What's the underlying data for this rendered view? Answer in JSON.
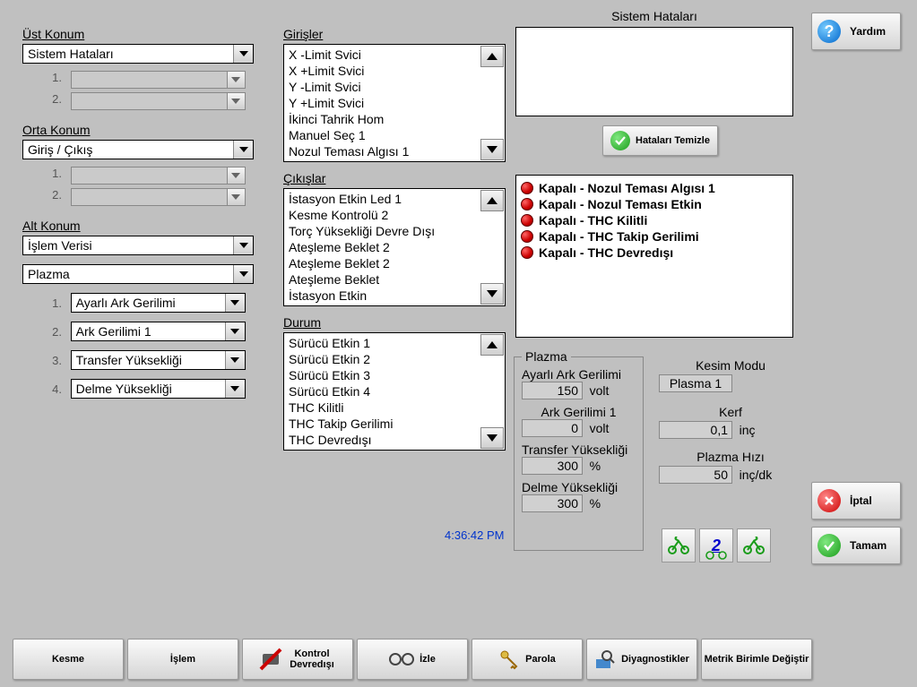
{
  "left": {
    "ust_konum": {
      "title": "Üst Konum",
      "value": "Sistem Hataları",
      "sub": [
        "",
        ""
      ]
    },
    "orta_konum": {
      "title": "Orta Konum",
      "value": "Giriş / Çıkış",
      "sub": [
        "",
        ""
      ]
    },
    "alt_konum": {
      "title": "Alt Konum",
      "value1": "İşlem Verisi",
      "value2": "Plazma",
      "items": [
        "Ayarlı Ark Gerilimi",
        "Ark Gerilimi 1",
        "Transfer Yüksekliği",
        "Delme Yüksekliği"
      ]
    }
  },
  "mid": {
    "girisler": {
      "title": "Girişler",
      "items": [
        "X -Limit Svici",
        "X +Limit Svici",
        "Y -Limit Svici",
        "Y +Limit Svici",
        "İkinci Tahrik Hom",
        "Manuel Seç 1",
        "Nozul Teması Algısı 1"
      ]
    },
    "cikislar": {
      "title": "Çıkışlar",
      "items": [
        "İstasyon Etkin Led 1",
        "Kesme Kontrolü 2",
        "Torç Yüksekliği Devre Dışı",
        "Ateşleme Beklet 2",
        "Ateşleme Beklet 2",
        "Ateşleme Beklet",
        "İstasyon Etkin"
      ]
    },
    "durum": {
      "title": "Durum",
      "items": [
        "Sürücü Etkin 1",
        "Sürücü Etkin 2",
        "Sürücü Etkin 3",
        "Sürücü Etkin 4",
        "THC Kilitli",
        "THC Takip Gerilimi",
        "THC Devredışı"
      ]
    }
  },
  "errors": {
    "title": "Sistem Hataları",
    "clear_label": "Hataları Temizle",
    "status_items": [
      "Kapalı - Nozul Teması Algısı 1",
      "Kapalı - Nozul Teması Etkin",
      "Kapalı - THC Kilitli",
      "Kapalı - THC Takip Gerilimi",
      "Kapalı - THC Devredışı"
    ]
  },
  "plazma": {
    "title": "Plazma",
    "ayarli_ark_gerilimi": {
      "label": "Ayarlı Ark Gerilimi",
      "value": "150",
      "unit": "volt"
    },
    "ark_gerilimi_1": {
      "label": "Ark Gerilimi 1",
      "value": "0",
      "unit": "volt"
    },
    "transfer_yuk": {
      "label": "Transfer Yüksekliği",
      "value": "300",
      "unit": "%"
    },
    "delme_yuk": {
      "label": "Delme Yüksekliği",
      "value": "300",
      "unit": "%"
    },
    "kesim_modu": {
      "label": "Kesim Modu",
      "value": "Plasma 1"
    },
    "kerf": {
      "label": "Kerf",
      "value": "0,1",
      "unit": "inç"
    },
    "plazma_hizi": {
      "label": "Plazma Hızı",
      "value": "50",
      "unit": "inç/dk"
    }
  },
  "buttons": {
    "yardim": "Yardım",
    "iptal": "İptal",
    "tamam": "Tamam",
    "jog_label": "2"
  },
  "bottom": {
    "kesme": "Kesme",
    "islem": "İşlem",
    "kontrol_devredisi": "Kontrol Devredışı",
    "izle": "İzle",
    "parola": "Parola",
    "diagnostikler": "Diyagnostikler",
    "metrik": "Metrik Birimle Değiştir"
  },
  "timestamp": "4:36:42 PM",
  "nums": [
    "1.",
    "2.",
    "3.",
    "4."
  ]
}
